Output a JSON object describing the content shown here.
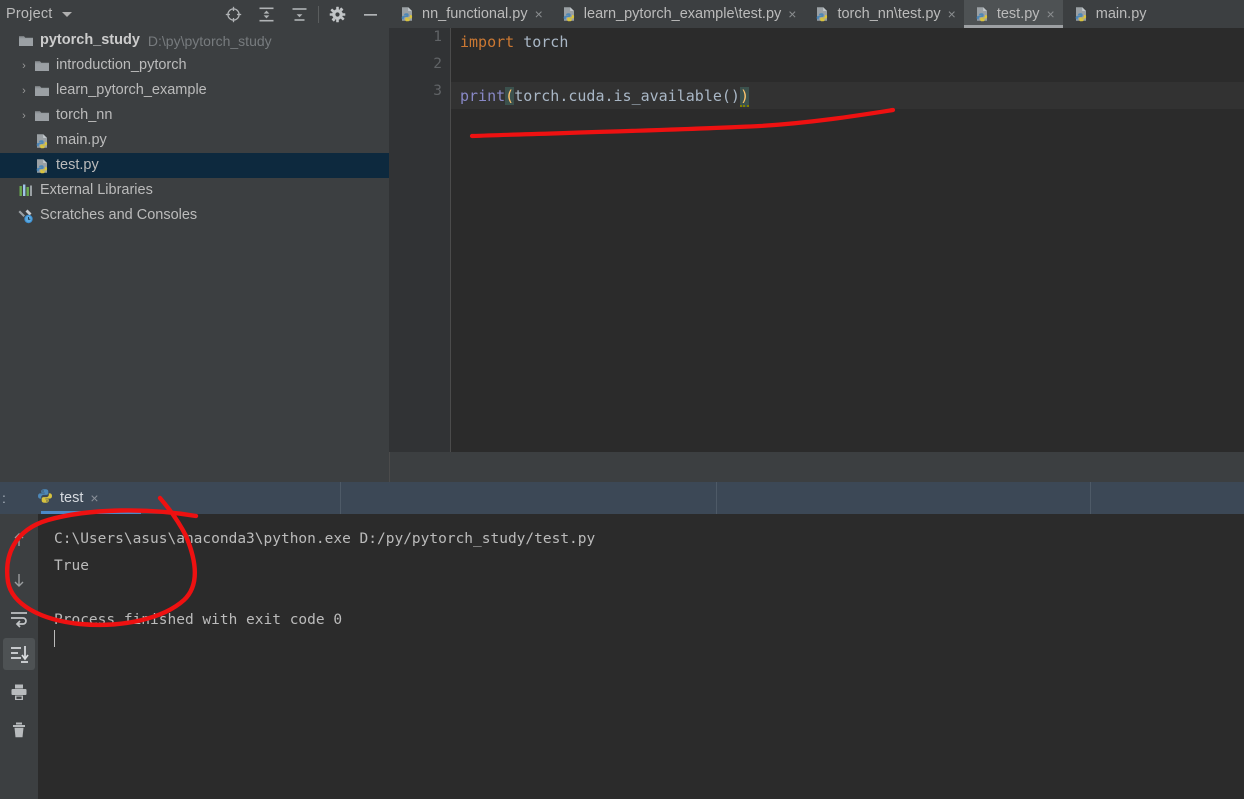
{
  "project_panel": {
    "title": "Project",
    "caret_icon": "chevron-down-icon",
    "tools": [
      {
        "name": "locate-icon",
        "label": "Select Opened File"
      },
      {
        "name": "expand-all-icon",
        "label": "Expand All"
      },
      {
        "name": "collapse-all-icon",
        "label": "Collapse All"
      },
      {
        "name": "gear-icon",
        "label": "Settings"
      },
      {
        "name": "minimize-icon",
        "label": "Hide"
      }
    ],
    "tree": [
      {
        "label": "pytorch_study",
        "sub": "D:\\py\\pytorch_study",
        "icon": "folder-icon",
        "arrow": false,
        "indent": 0,
        "bold": true,
        "selected": false
      },
      {
        "label": "introduction_pytorch",
        "sub": "",
        "icon": "folder-icon",
        "arrow": true,
        "indent": 1,
        "bold": false,
        "selected": false
      },
      {
        "label": "learn_pytorch_example",
        "sub": "",
        "icon": "folder-icon",
        "arrow": true,
        "indent": 1,
        "bold": false,
        "selected": false
      },
      {
        "label": "torch_nn",
        "sub": "",
        "icon": "folder-icon",
        "arrow": true,
        "indent": 1,
        "bold": false,
        "selected": false
      },
      {
        "label": "main.py",
        "sub": "",
        "icon": "python-file-icon",
        "arrow": false,
        "indent": 1,
        "bold": false,
        "selected": false
      },
      {
        "label": "test.py",
        "sub": "",
        "icon": "python-file-icon",
        "arrow": false,
        "indent": 1,
        "bold": false,
        "selected": true
      },
      {
        "label": "External Libraries",
        "sub": "",
        "icon": "libraries-icon",
        "arrow": false,
        "indent": 0,
        "bold": false,
        "selected": false
      },
      {
        "label": "Scratches and Consoles",
        "sub": "",
        "icon": "scratches-icon",
        "arrow": false,
        "indent": 0,
        "bold": false,
        "selected": false
      }
    ]
  },
  "editor": {
    "tabs": [
      {
        "label": "nn_functional.py",
        "icon": "python-file-icon",
        "active": false,
        "close": "×"
      },
      {
        "label": "learn_pytorch_example\\test.py",
        "icon": "python-file-icon",
        "active": false,
        "close": "×"
      },
      {
        "label": "torch_nn\\test.py",
        "icon": "python-file-icon",
        "active": false,
        "close": "×"
      },
      {
        "label": "test.py",
        "icon": "python-file-icon",
        "active": true,
        "close": "×"
      },
      {
        "label": "main.py",
        "icon": "python-file-icon",
        "active": false,
        "close": ""
      }
    ],
    "line_numbers": [
      "1",
      "2",
      "3"
    ],
    "code": {
      "line1_kw": "import",
      "line1_id": " torch",
      "line3_fn": "print",
      "line3_open": "(",
      "line3_body": "torch.cuda.is_available()",
      "line3_close": ")"
    }
  },
  "console": {
    "prefix": ":",
    "tab_label": "test",
    "tab_icon": "python-icon",
    "tab_close": "×",
    "sidebar_buttons": [
      {
        "name": "up-arrow-icon",
        "active": false
      },
      {
        "name": "down-arrow-icon",
        "active": false
      },
      {
        "name": "soft-wrap-icon",
        "active": false
      },
      {
        "name": "scroll-to-end-icon",
        "active": true
      },
      {
        "name": "print-icon",
        "active": false
      },
      {
        "name": "trash-icon",
        "active": false
      }
    ],
    "output_lines": [
      "C:\\Users\\asus\\anaconda3\\python.exe D:/py/pytorch_study/test.py",
      "True",
      "",
      "Process finished with exit code 0"
    ]
  },
  "colors": {
    "panel_bg": "#3c3f41",
    "editor_bg": "#2b2b2b",
    "gutter_bg": "#313335",
    "selection_bg": "#0d293e",
    "console_tabbar_bg": "#3c4856",
    "tab_active_bg": "#4e5254",
    "accent_blue": "#4a88c7",
    "annotation_red": "#ee1111",
    "keyword_orange": "#cc7832",
    "identifier_gray": "#a9b7c6",
    "function_purple": "#8888c6",
    "paren_yellow": "#ffc66d"
  },
  "annotations": {
    "underline_note": "red hand-drawn underline under code line 3",
    "circle_note": "red hand-drawn ellipse around console output"
  }
}
